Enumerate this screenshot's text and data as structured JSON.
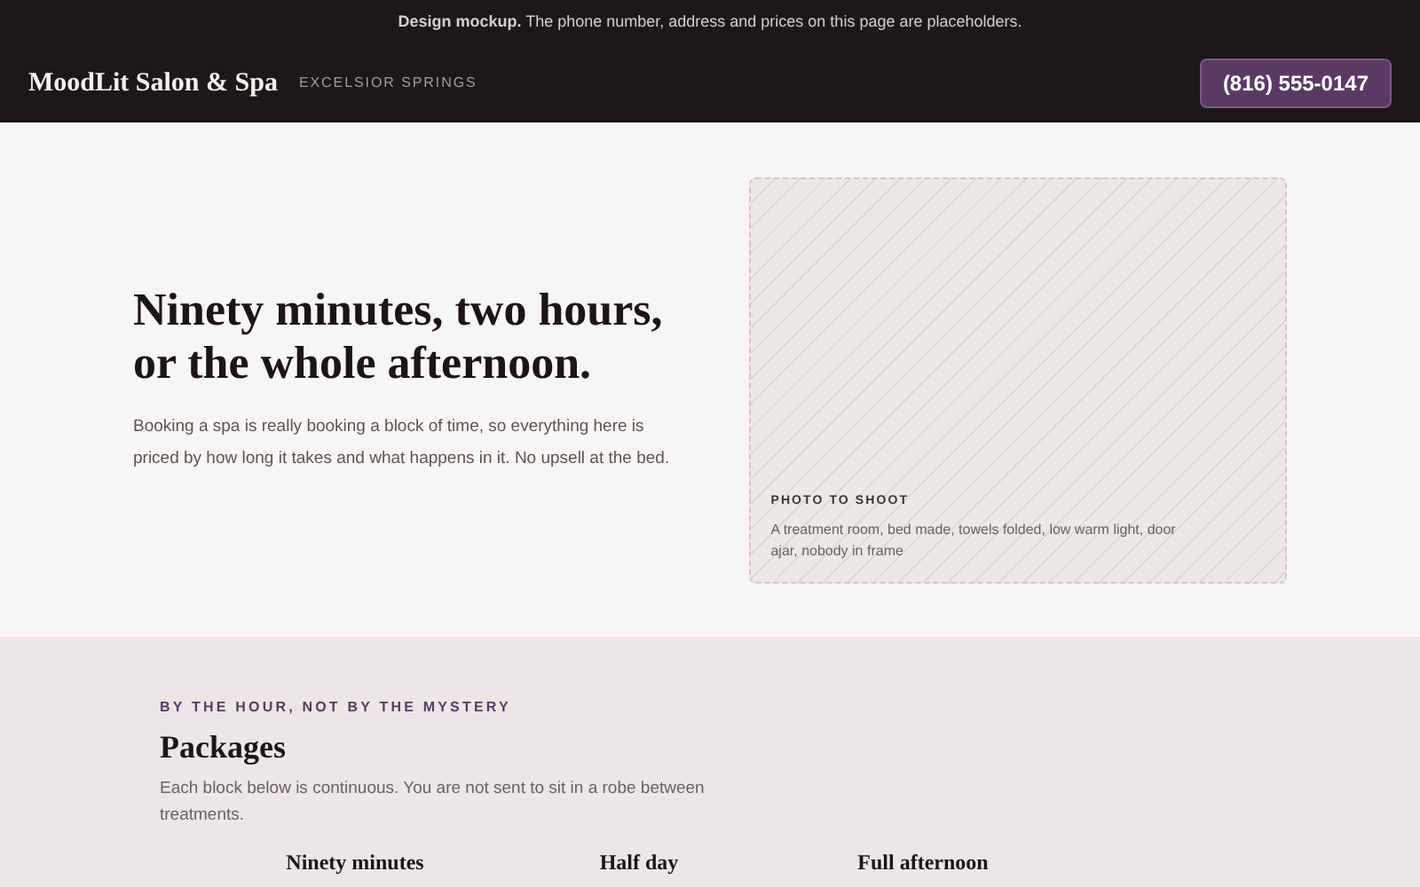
{
  "banner": {
    "text": "**Design mockup.** The phone number, address and prices on this page are placeholders."
  },
  "header": {
    "brand": "MoodLit Salon & Spa",
    "location": "EXCELSIOR SPRINGS",
    "phone_button": "(816) 555-0147"
  },
  "hero": {
    "heading": "Ninety minutes, two hours, or the whole afternoon.",
    "body": "Booking a spa is really booking a block of time, so everything here is priced by how long it takes and what happens in it. No upsell at the bed.",
    "photo": {
      "label": "PHOTO TO SHOOT",
      "caption": "A treatment room, bed made, towels folded, low warm light, door ajar, nobody in frame"
    }
  },
  "packages": {
    "eyebrow": "BY THE HOUR, NOT BY THE MYSTERY",
    "heading": "Packages",
    "intro": "Each block below is continuous. You are not sent to sit in a robe between treatments.",
    "items": [
      {
        "title": "Ninety minutes"
      },
      {
        "title": "Half day"
      },
      {
        "title": "Full afternoon"
      }
    ]
  }
}
